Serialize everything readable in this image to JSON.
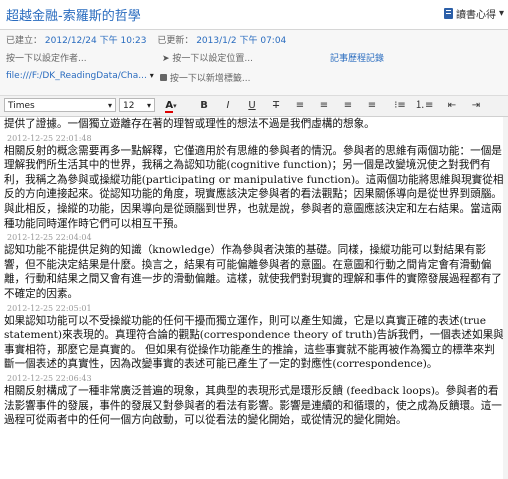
{
  "title": "超越金融-索羅斯的哲學",
  "notebook": {
    "label": "讀書心得"
  },
  "meta": {
    "created_label": "已建立：",
    "created_value": "2012/12/24 下午 10:23",
    "updated_label": "已更新：",
    "updated_value": "2013/1/2 下午 07:04",
    "author_placeholder": "按一下以設定作者...",
    "location_placeholder": "按一下以設定位置...",
    "history_link": "記事歷程記錄",
    "source_value": "file:///F:/DK_ReadingData/Cha...",
    "tags_placeholder": "按一下以新增標籤..."
  },
  "toolbar": {
    "font": "Times",
    "size": "12",
    "bold": "B",
    "italic": "I",
    "underline": "U",
    "strike": "T"
  },
  "entries": [
    {
      "stamp": "",
      "text": "提供了證據。一個獨立遊離存在著的理智或理性的想法不過是我們虛構的想象。"
    },
    {
      "stamp": "2012-12-25 22:01:48",
      "text": "相關反射的概念需要再多一點解釋，它僅適用於有思維的參與者的情況。參與者的思維有兩個功能：一個是理解我們所生活其中的世界，我稱之為認知功能(cognitive function)；另一個是改變境況使之對我們有利，我稱之為參與或操縱功能(participating or manipulative function)。這兩個功能將思維與現實從相反的方向連接起來。從認知功能的角度，現實應該決定參與者的看法觀點；因果關係導向是從世界到頭腦。與此相反，操縱的功能，因果導向是從頭腦到世界，也就是說，參與者的意圖應該決定和左右結果。當這兩種功能同時運作時它們可以相互干預。"
    },
    {
      "stamp": "2012-12-25 22:04:04",
      "text": "認知功能不能提供足夠的知識（knowledge）作為參與者決策的基礎。同樣，操縱功能可以對結果有影響，但不能決定結果是什麼。換言之，結果有可能偏離參與者的意圖。在意圖和行動之間肯定會有滑動偏離，行動和結果之間又會有進一步的滑動偏離。這樣，就使我們對現實的理解和事件的實際發展過程都有了不確定的因素。"
    },
    {
      "stamp": "2012-12-25 22:05:01",
      "text": "如果認知功能可以不受操縱功能的任何干擾而獨立運作，則可以產生知識，它是以真實正確的表述(true statement)來表現的。真理符合論的觀點(correspondence theory of truth)告訴我們，一個表述如果與事實相符，那麼它是真實的。  但如果有從操作功能產生的推論，這些事實就不能再被作為獨立的標準來判斷一個表述的真實性，因為改變事實的表述可能已產生了一定的對應性(correspondence)。"
    },
    {
      "stamp": "2012-12-25 22:06:43",
      "text": "相關反射構成了一種非常廣泛普遍的現象，其典型的表現形式是環形反饋 (feedback loops)。參與者的看法影響事件的發展，事件的發展又對參與者的看法有影響。影響是連續的和循環的，使之成為反饋環。這一過程可從兩者中的任何一個方向啟動，可以從看法的變化開始，或從情況的變化開始。"
    }
  ]
}
